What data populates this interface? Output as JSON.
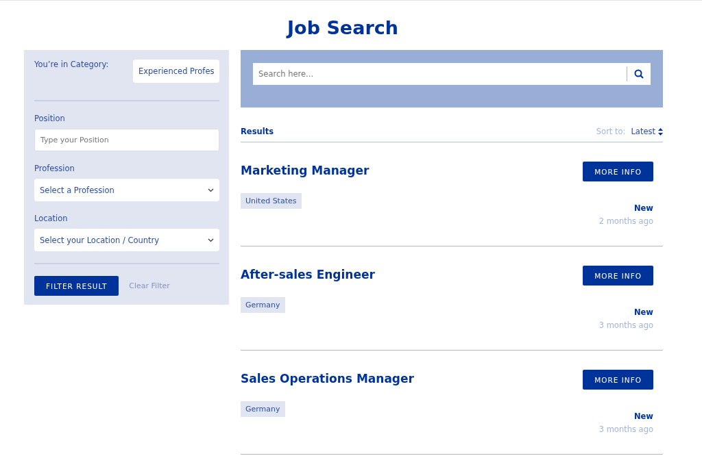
{
  "title": "Job Search",
  "filters": {
    "category_label": "You’re in Category:",
    "category_value": "Experienced Profes",
    "position_label": "Position",
    "position_placeholder": "Type your Position",
    "profession_label": "Profession",
    "profession_value": "Select a Profession",
    "location_label": "Location",
    "location_value": "Select your Location / Country",
    "filter_button": "FILTER RESULT",
    "clear_link": "Clear Filter"
  },
  "search": {
    "placeholder": "Search here..."
  },
  "results": {
    "heading": "Results",
    "sort_label": "Sort to:",
    "sort_value": "Latest"
  },
  "jobs": [
    {
      "title": "Marketing Manager",
      "location": "United States",
      "button": "MORE INFO",
      "badge": "New",
      "posted": "2 months ago"
    },
    {
      "title": "After-sales Engineer",
      "location": "Germany",
      "button": "MORE INFO",
      "badge": "New",
      "posted": "3 months ago"
    },
    {
      "title": "Sales Operations Manager",
      "location": "Germany",
      "button": "MORE INFO",
      "badge": "New",
      "posted": "3 months ago"
    }
  ]
}
